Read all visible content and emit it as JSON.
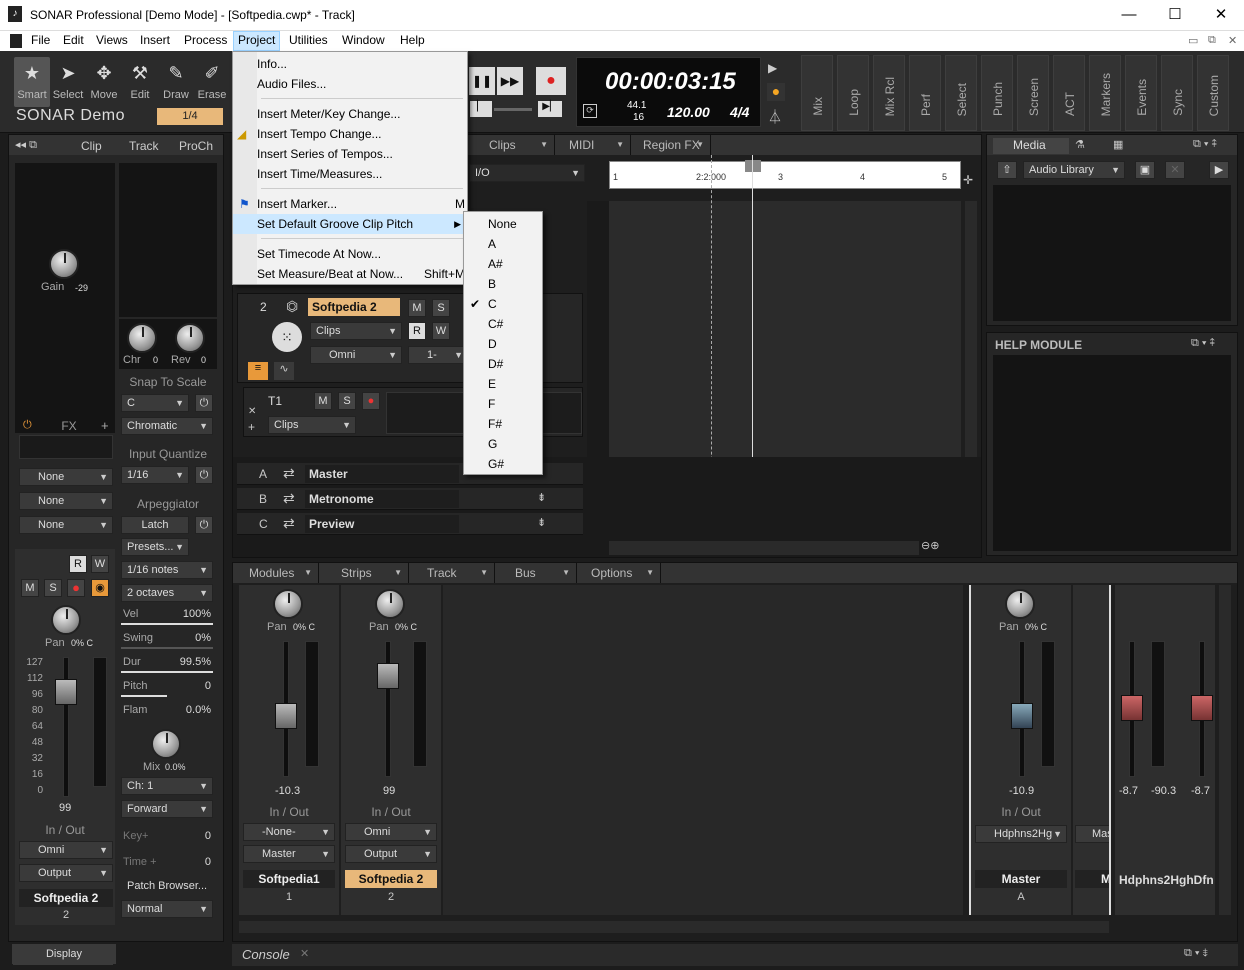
{
  "app": {
    "title": "SONAR Professional [Demo Mode] - [Softpedia.cwp* - Track]"
  },
  "menubar": [
    "File",
    "Edit",
    "Views",
    "Insert",
    "Process",
    "Project",
    "Utilities",
    "Window",
    "Help"
  ],
  "toolbar": {
    "tools": [
      "Smart",
      "Select",
      "Move",
      "Edit",
      "Draw",
      "Erase"
    ],
    "product": "SONAR Demo",
    "snap": "1/4",
    "time": "00:00:03:15",
    "sample_rate": "44.1",
    "bit_depth": "16",
    "tempo": "120.00",
    "meter": "4/4",
    "vtabs": [
      "Mix",
      "Loop",
      "Mix Rcl",
      "Perf",
      "Select",
      "Punch",
      "Screen",
      "ACT",
      "Markers",
      "Events",
      "Sync",
      "Custom"
    ]
  },
  "inspector": {
    "tabs": [
      "Clip",
      "Track",
      "ProCh"
    ],
    "gain_label": "Gain",
    "gain_value": "-29",
    "chr_label": "Chr",
    "chr_value": "0",
    "rev_label": "Rev",
    "rev_value": "0",
    "snap_to_scale": "Snap To Scale",
    "scale_root": "C",
    "scale_type": "Chromatic",
    "input_quantize": "Input Quantize",
    "iq_value": "1/16",
    "arpeggiator": "Arpeggiator",
    "latch": "Latch",
    "presets": "Presets...",
    "notes": "1/16 notes",
    "octaves": "2 octaves",
    "arp_params": [
      {
        "name": "Vel",
        "value": "100%"
      },
      {
        "name": "Swing",
        "value": "0%"
      },
      {
        "name": "Dur",
        "value": "99.5%"
      },
      {
        "name": "Pitch",
        "value": "0"
      },
      {
        "name": "Flam",
        "value": "0.0%"
      }
    ],
    "mix_label": "Mix",
    "mix_value": "0.0%",
    "channel": "Ch: 1",
    "direction": "Forward",
    "key_label": "Key+",
    "key_value": "0",
    "time_label": "Time +",
    "time_value": "0",
    "patch_browser": "Patch Browser...",
    "mode": "Normal",
    "fx_label": "FX",
    "none_slots": [
      "None",
      "None",
      "None"
    ],
    "pan_label": "Pan",
    "pan_value": "0% C",
    "fader_value": "99",
    "fader_scale": [
      "127",
      "112",
      "96",
      "80",
      "64",
      "48",
      "32",
      "16",
      "0"
    ],
    "inout_label": "In / Out",
    "input": "Omni",
    "output": "Output",
    "track_name": "Softpedia 2",
    "track_num": "2",
    "display": "Display"
  },
  "trackview": {
    "tabs": [
      "Clips",
      "MIDI",
      "Region FX"
    ],
    "io_label": "I/O",
    "ruler": [
      "1",
      "2:2:000",
      "3",
      "4",
      "5"
    ],
    "track2": {
      "num": "2",
      "name": "Softpedia 2",
      "clips": "Clips",
      "input": "Omni",
      "output": "1-"
    },
    "take": {
      "name": "T1",
      "clips": "Clips"
    },
    "buses": [
      {
        "letter": "A",
        "name": "Master"
      },
      {
        "letter": "B",
        "name": "Metronome"
      },
      {
        "letter": "C",
        "name": "Preview"
      }
    ]
  },
  "project_menu": {
    "items": [
      {
        "label": "Info...",
        "shortcut": ""
      },
      {
        "label": "Audio Files...",
        "shortcut": ""
      },
      {
        "label": "Insert Meter/Key Change...",
        "shortcut": ""
      },
      {
        "label": "Insert Tempo Change...",
        "shortcut": ""
      },
      {
        "label": "Insert Series of Tempos...",
        "shortcut": ""
      },
      {
        "label": "Insert Time/Measures...",
        "shortcut": ""
      },
      {
        "label": "Insert Marker...",
        "shortcut": "M"
      },
      {
        "label": "Set Default Groove Clip Pitch",
        "shortcut": "▶"
      },
      {
        "label": "Set Timecode At Now...",
        "shortcut": ""
      },
      {
        "label": "Set Measure/Beat at Now...",
        "shortcut": "Shift+M"
      }
    ]
  },
  "pitch_menu": {
    "items": [
      "None",
      "A",
      "A#",
      "B",
      "C",
      "C#",
      "D",
      "D#",
      "E",
      "F",
      "F#",
      "G",
      "G#"
    ],
    "checked": "C"
  },
  "browser": {
    "tab": "Media",
    "library": "Audio Library"
  },
  "help_module": {
    "title": "HELP MODULE"
  },
  "console": {
    "tabs": [
      "Modules",
      "Strips",
      "Track",
      "Bus",
      "Options"
    ],
    "label": "Console",
    "strips": [
      {
        "name": "Softpedia1",
        "num": "1",
        "fader": "-10.3",
        "input": "-None-",
        "output": "Master",
        "pan": "0% C"
      },
      {
        "name": "Softpedia 2",
        "num": "2",
        "fader": "99",
        "input": "Omni",
        "output": "Output",
        "pan": "0% C"
      }
    ],
    "buses": [
      {
        "name": "Master",
        "letter": "A",
        "fader": "-10.9",
        "output": "Hdphns2Hg",
        "pan": "0% C"
      },
      {
        "name": "Me",
        "output": "Mas"
      }
    ],
    "hw": {
      "name": "Hdphns2HghDfn",
      "l": "-8.7",
      "peak": "-90.3",
      "r": "-8.7"
    },
    "inout": "In / Out"
  }
}
